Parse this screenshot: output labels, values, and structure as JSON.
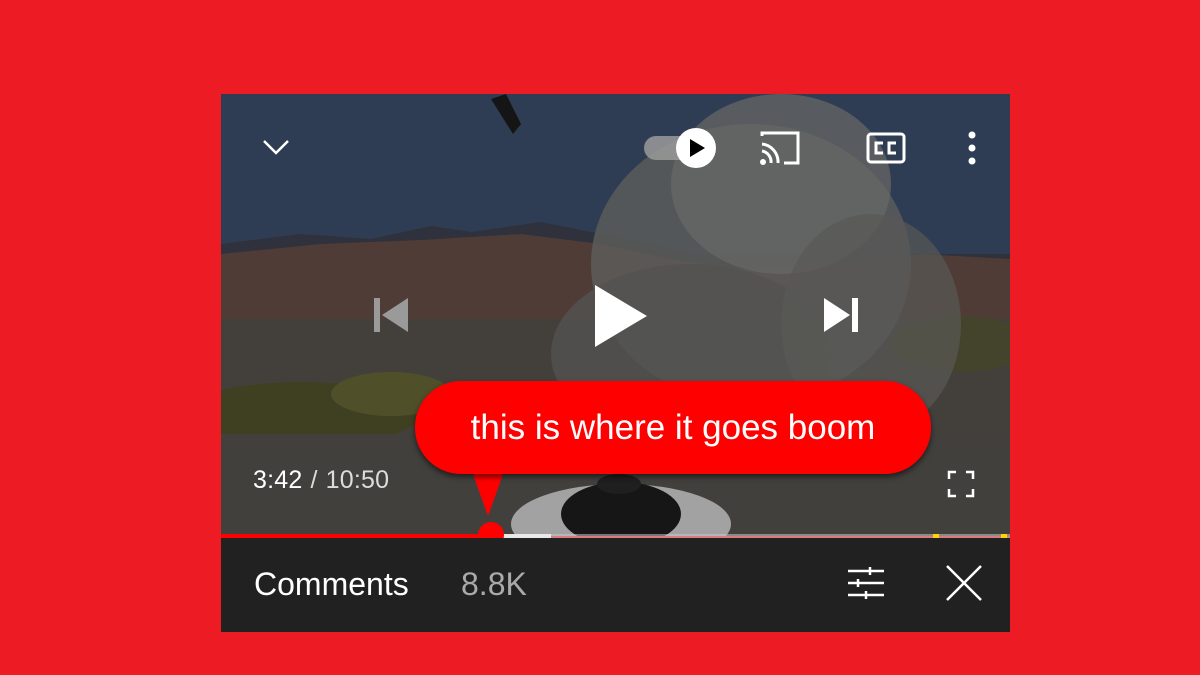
{
  "player": {
    "current_time": "3:42",
    "separator": "/",
    "total_time": "10:50",
    "played_fraction": 0.342,
    "callout": "this is where it goes boom",
    "autoplay": "on"
  },
  "comments": {
    "title": "Comments",
    "count": "8.8K"
  },
  "colors": {
    "background": "#ED1C24",
    "accent": "#FF0000",
    "bar": "#212121",
    "ad_marker": "#FFD400"
  },
  "icons": [
    "chevron-down-icon",
    "autoplay-toggle-icon",
    "cast-icon",
    "closed-captions-icon",
    "more-vert-icon",
    "previous-icon",
    "play-icon",
    "next-icon",
    "fullscreen-icon",
    "sort-icon",
    "close-icon"
  ]
}
